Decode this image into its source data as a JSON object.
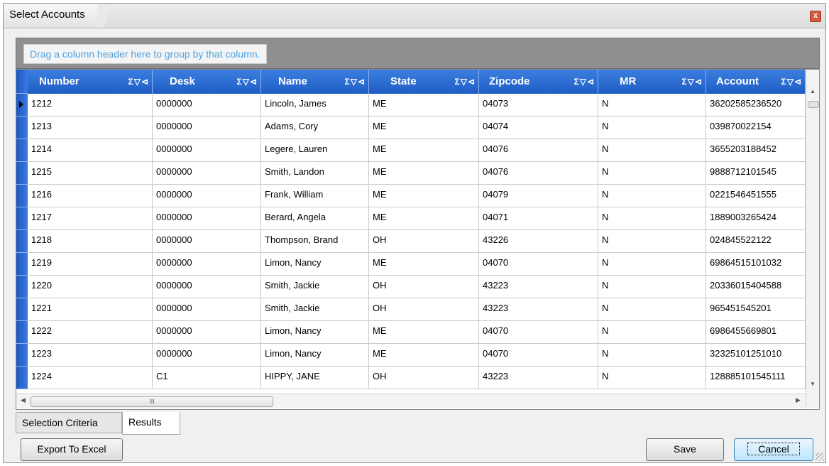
{
  "window": {
    "title": "Select Accounts",
    "close_glyph": "x"
  },
  "group_panel": {
    "hint": "Drag a column header here to group by that column."
  },
  "grid": {
    "header_tools": "Σ▽⊲",
    "columns": [
      "Number",
      "Desk",
      "Name",
      "State",
      "Zipcode",
      "MR",
      "Account"
    ],
    "rows": [
      [
        "1212",
        "0000000",
        "Lincoln, James",
        "ME",
        "04073",
        "N",
        "36202585236520"
      ],
      [
        "1213",
        "0000000",
        "Adams, Cory",
        "ME",
        "04074",
        "N",
        "039870022154"
      ],
      [
        "1214",
        "0000000",
        "Legere, Lauren",
        "ME",
        "04076",
        "N",
        "3655203188452"
      ],
      [
        "1215",
        "0000000",
        "Smith, Landon",
        "ME",
        "04076",
        "N",
        "9888712101545"
      ],
      [
        "1216",
        "0000000",
        "Frank, William",
        "ME",
        "04079",
        "N",
        "0221546451555"
      ],
      [
        "1217",
        "0000000",
        "Berard, Angela",
        "ME",
        "04071",
        "N",
        "1889003265424"
      ],
      [
        "1218",
        "0000000",
        "Thompson, Brand",
        "OH",
        "43226",
        "N",
        "024845522122"
      ],
      [
        "1219",
        "0000000",
        "Limon, Nancy",
        "ME",
        "04070",
        "N",
        "69864515101032"
      ],
      [
        "1220",
        "0000000",
        "Smith, Jackie",
        "OH",
        "43223",
        "N",
        "20336015404588"
      ],
      [
        "1221",
        "0000000",
        "Smith, Jackie",
        "OH",
        "43223",
        "N",
        "965451545201"
      ],
      [
        "1222",
        "0000000",
        "Limon, Nancy",
        "ME",
        "04070",
        "N",
        "6986455669801"
      ],
      [
        "1223",
        "0000000",
        "Limon, Nancy",
        "ME",
        "04070",
        "N",
        "32325101251010"
      ],
      [
        "1224",
        "C1",
        "HIPPY, JANE",
        "OH",
        "43223",
        "N",
        "128885101545111"
      ]
    ],
    "hscroll_grip": "III"
  },
  "tabs": [
    {
      "label": "Selection Criteria",
      "active": false
    },
    {
      "label": "Results",
      "active": true
    }
  ],
  "buttons": {
    "export": "Export To Excel",
    "save": "Save",
    "cancel": "Cancel"
  },
  "colors": {
    "header_blue": "#2a6ad6",
    "hint_text": "#4aa3e6",
    "panel_gray": "#8f8f8f"
  }
}
